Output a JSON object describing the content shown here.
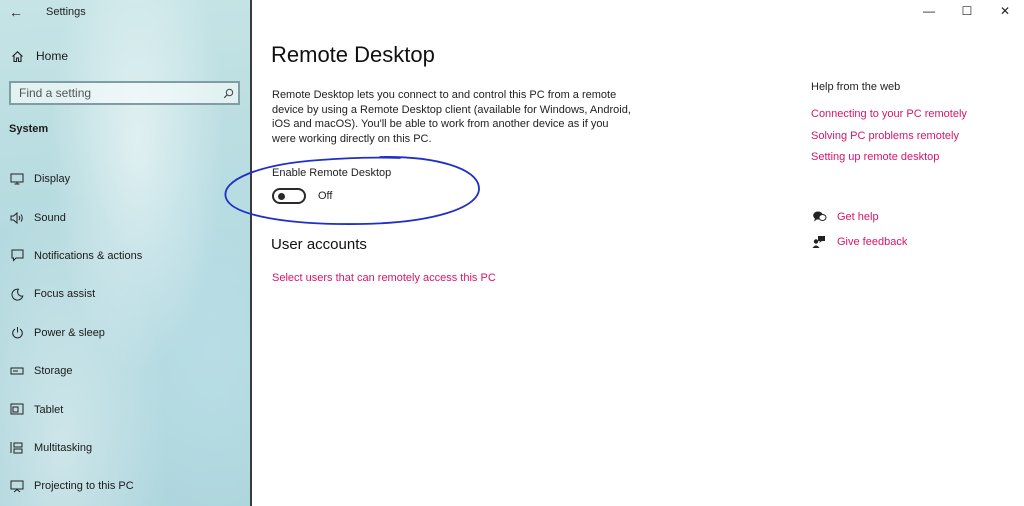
{
  "window": {
    "title": "Settings",
    "back_glyph": "←",
    "minimize_glyph": "—",
    "maximize_glyph": "☐",
    "close_glyph": "✕"
  },
  "sidebar": {
    "home_label": "Home",
    "search_placeholder": "Find a setting",
    "section_title": "System",
    "items": [
      {
        "label": "Display",
        "icon": "display-icon"
      },
      {
        "label": "Sound",
        "icon": "sound-icon"
      },
      {
        "label": "Notifications & actions",
        "icon": "notifications-icon"
      },
      {
        "label": "Focus assist",
        "icon": "focus-assist-icon"
      },
      {
        "label": "Power & sleep",
        "icon": "power-icon"
      },
      {
        "label": "Storage",
        "icon": "storage-icon"
      },
      {
        "label": "Tablet",
        "icon": "tablet-icon"
      },
      {
        "label": "Multitasking",
        "icon": "multitasking-icon"
      },
      {
        "label": "Projecting to this PC",
        "icon": "projecting-icon"
      }
    ]
  },
  "main": {
    "title": "Remote Desktop",
    "description": "Remote Desktop lets you connect to and control this PC from a remote device by using a Remote Desktop client (available for Windows, Android, iOS and macOS). You'll be able to work from another device as if you were working directly on this PC.",
    "toggle": {
      "label": "Enable Remote Desktop",
      "state_text": "Off",
      "on": false
    },
    "user_accounts": {
      "heading": "User accounts",
      "link": "Select users that can remotely access this PC"
    }
  },
  "help": {
    "title": "Help from the web",
    "links": [
      "Connecting to your PC remotely",
      "Solving PC problems remotely",
      "Setting up remote desktop"
    ],
    "get_help": "Get help",
    "give_feedback": "Give feedback"
  },
  "colors": {
    "accent_link": "#d6156a",
    "annotation_ink": "#1f2fc8",
    "sidebar_bg": "#b4dadf"
  }
}
